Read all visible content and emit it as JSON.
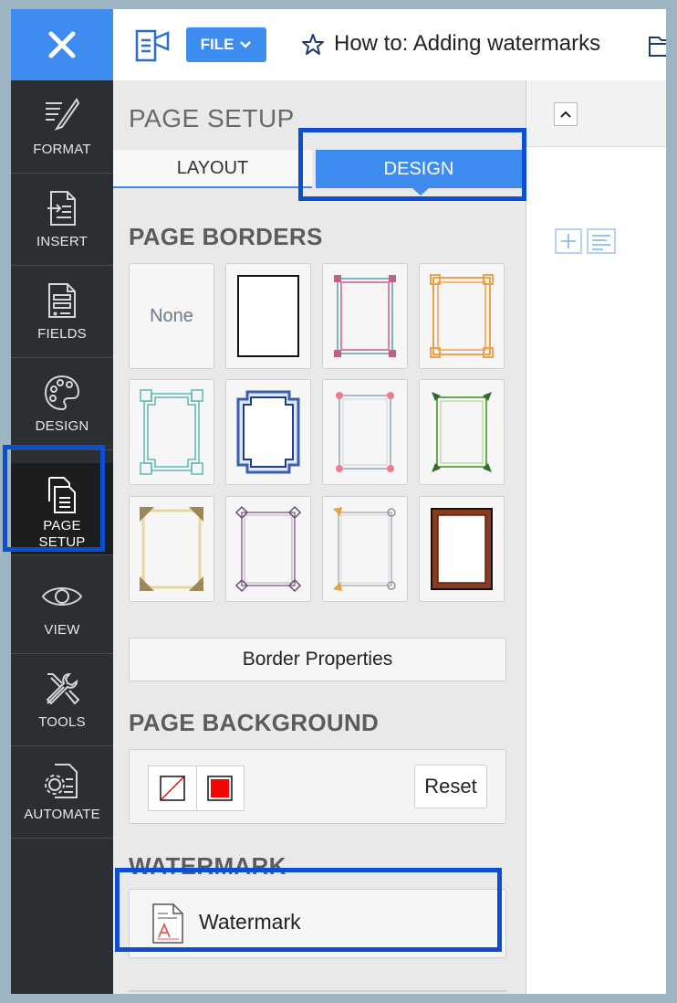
{
  "topbar": {
    "file_label": "FILE",
    "document_title": "How to: Adding watermarks"
  },
  "rail": {
    "items": [
      {
        "label": "FORMAT",
        "icon": "format-brush-icon"
      },
      {
        "label": "INSERT",
        "icon": "insert-document-icon"
      },
      {
        "label": "FIELDS",
        "icon": "fields-document-icon"
      },
      {
        "label": "DESIGN",
        "icon": "palette-icon"
      },
      {
        "label_line1": "PAGE",
        "label_line2": "SETUP",
        "icon": "page-setup-icon",
        "active": true
      },
      {
        "label": "VIEW",
        "icon": "eye-icon"
      },
      {
        "label": "TOOLS",
        "icon": "tools-icon"
      },
      {
        "label": "AUTOMATE",
        "icon": "automate-gear-icon"
      }
    ]
  },
  "panel": {
    "title": "PAGE SETUP",
    "tabs": {
      "layout": "LAYOUT",
      "design": "DESIGN",
      "active": "DESIGN"
    },
    "page_borders": {
      "heading": "PAGE BORDERS",
      "none_label": "None",
      "border_properties_label": "Border Properties"
    },
    "page_background": {
      "heading": "PAGE BACKGROUND",
      "reset_label": "Reset",
      "selected_color": "#ff0000"
    },
    "watermark": {
      "heading": "WATERMARK",
      "button_label": "Watermark"
    }
  },
  "colors": {
    "accent": "#3f8cf0",
    "highlight": "#0a4fd1",
    "rail_bg": "#2b2f33"
  }
}
